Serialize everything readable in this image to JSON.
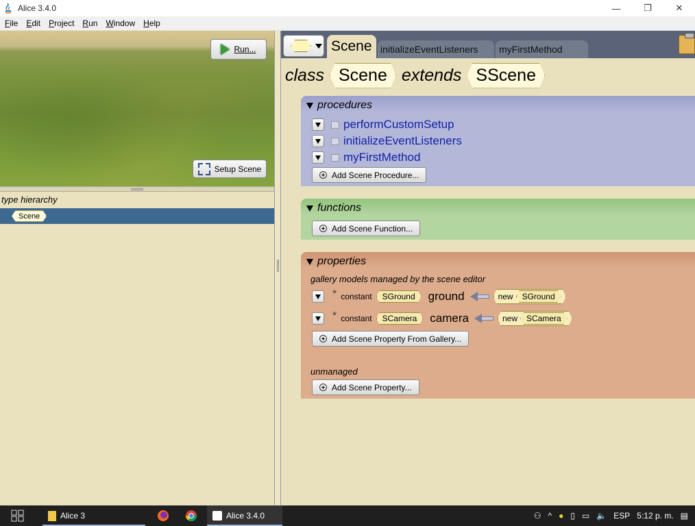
{
  "window": {
    "title": "Alice 3.4.0",
    "controls": {
      "minimize": "—",
      "maximize": "❐",
      "close": "✕"
    }
  },
  "menu": [
    {
      "label": "File",
      "key": "F"
    },
    {
      "label": "Edit",
      "key": "E"
    },
    {
      "label": "Project",
      "key": "P"
    },
    {
      "label": "Run",
      "key": "R"
    },
    {
      "label": "Window",
      "key": "W"
    },
    {
      "label": "Help",
      "key": "H"
    }
  ],
  "scene_view": {
    "run_label": "Run...",
    "setup_label": "Setup Scene"
  },
  "type_hierarchy": {
    "label": "type hierarchy",
    "selected": "Scene"
  },
  "tabs": {
    "active": "Scene",
    "others": [
      "initializeEventListeners",
      "myFirstMethod"
    ]
  },
  "class_decl": {
    "class_kw": "class",
    "name": "Scene",
    "extends_kw": "extends",
    "parent": "SScene"
  },
  "procedures": {
    "header": "procedures",
    "items": [
      "performCustomSetup",
      "initializeEventListeners",
      "myFirstMethod"
    ],
    "add_label": "Add Scene Procedure..."
  },
  "functions": {
    "header": "functions",
    "add_label": "Add Scene Function..."
  },
  "properties": {
    "header": "properties",
    "gallery_label": "gallery models managed by the scene editor",
    "rows": [
      {
        "star": "*",
        "modifier": "constant",
        "type": "SGround",
        "name": "ground",
        "new_kw": "new",
        "new_type": "SGround"
      },
      {
        "star": "*",
        "modifier": "constant",
        "type": "SCamera",
        "name": "camera",
        "new_kw": "new",
        "new_type": "SCamera"
      }
    ],
    "add_gallery_label": "Add Scene Property From Gallery...",
    "unmanaged_label": "unmanaged",
    "add_label": "Add Scene Property..."
  },
  "taskbar": {
    "folder_label": "Alice 3",
    "app_label": "Alice 3.4.0",
    "lang": "ESP",
    "time": "5:12 p. m."
  },
  "colors": {
    "procedures_bg": "#b3b7d8",
    "functions_bg": "#b3d5a0",
    "properties_bg": "#dcac8c",
    "editor_bg": "#e9e1bd",
    "selection": "#3d6991",
    "method_name": "#1221a8"
  }
}
